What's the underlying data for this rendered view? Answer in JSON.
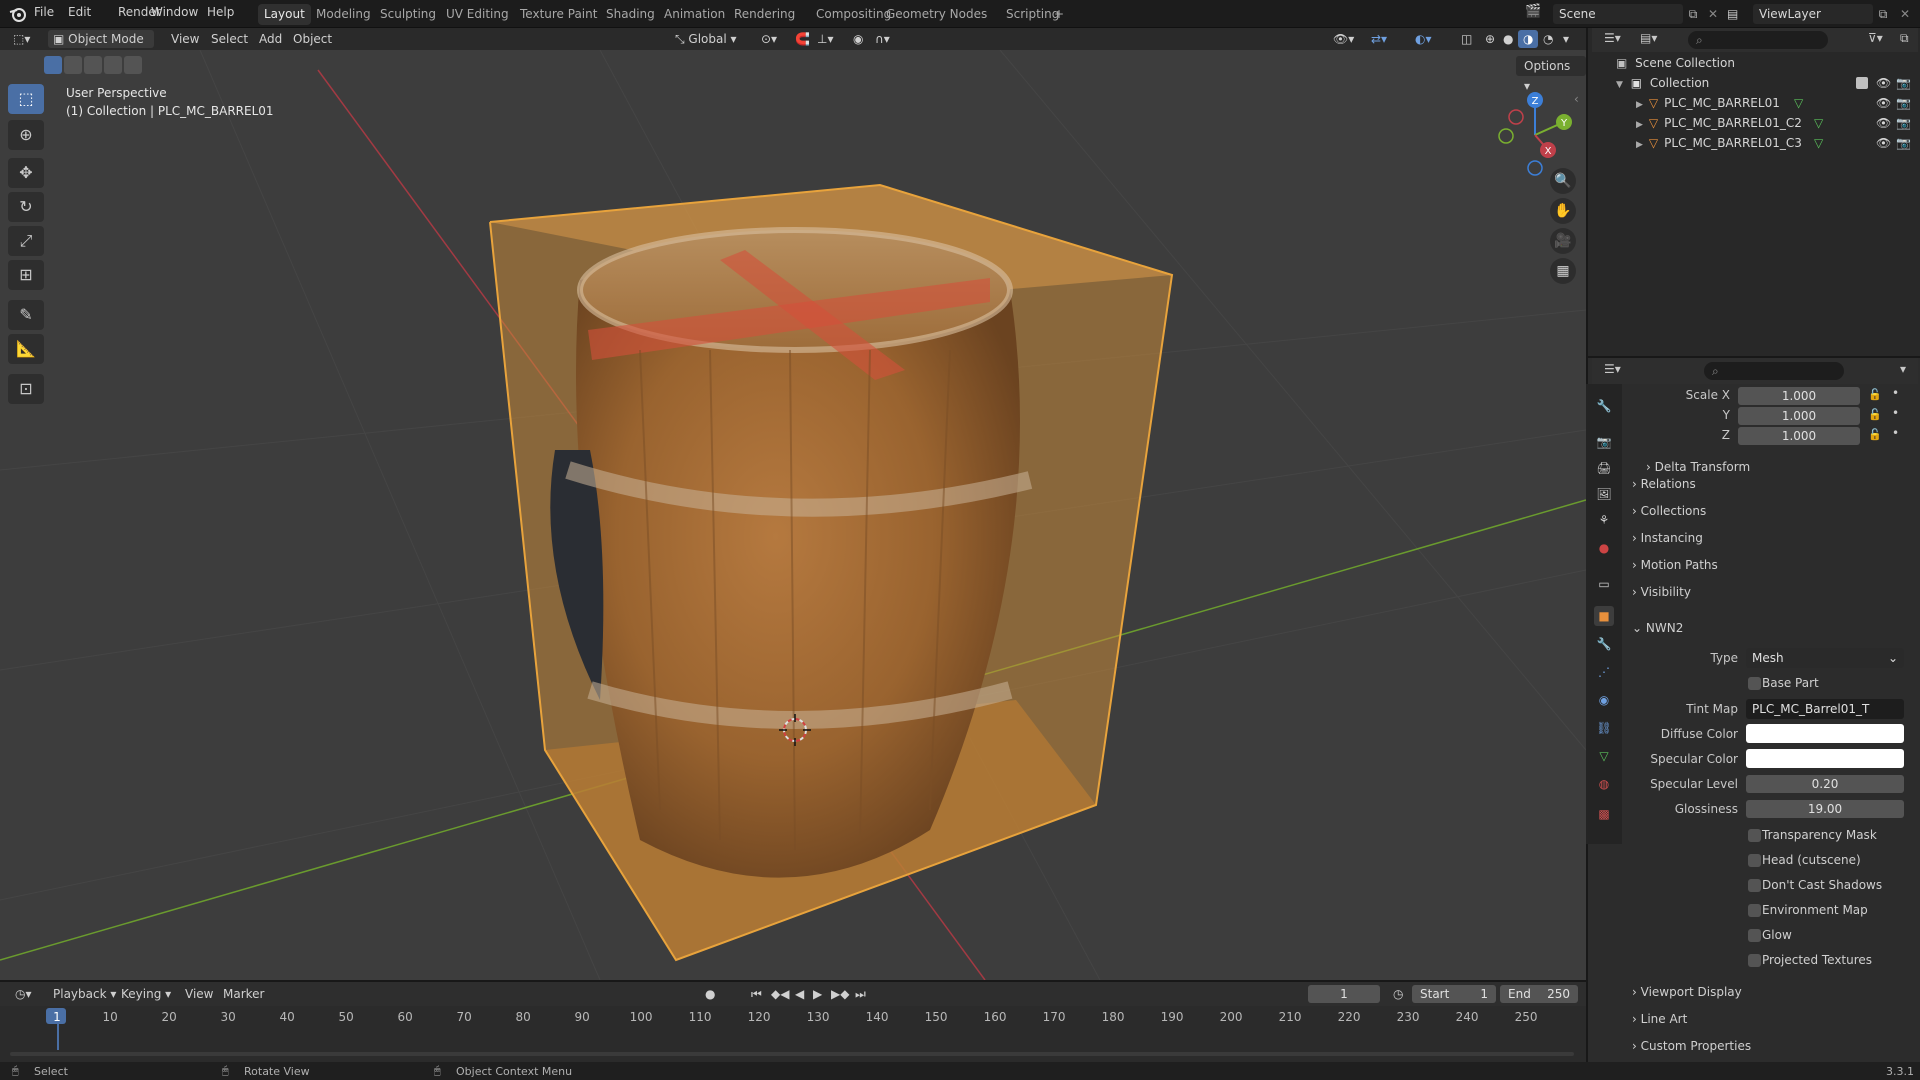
{
  "menu": {
    "file": "File",
    "edit": "Edit",
    "render": "Render",
    "window": "Window",
    "help": "Help"
  },
  "workspaces": [
    "Layout",
    "Modeling",
    "Sculpting",
    "UV Editing",
    "Texture Paint",
    "Shading",
    "Animation",
    "Rendering",
    "Compositing",
    "Geometry Nodes",
    "Scripting",
    "+"
  ],
  "scene": {
    "name": "Scene",
    "view_layer": "ViewLayer"
  },
  "viewport_header": {
    "mode": "Object Mode",
    "view": "View",
    "select": "Select",
    "add": "Add",
    "object": "Object",
    "orientation": "Global",
    "options": "Options"
  },
  "viewport": {
    "perspective": "User Perspective",
    "collection_info": "(1) Collection | PLC_MC_BARREL01"
  },
  "gizmo": {
    "x": "X",
    "y": "Y",
    "z": "Z"
  },
  "outliner": {
    "scene_collection": "Scene Collection",
    "collection": "Collection",
    "objects": [
      "PLC_MC_BARREL01",
      "PLC_MC_BARREL01_C2",
      "PLC_MC_BARREL01_C3"
    ]
  },
  "properties": {
    "scale": {
      "label_x": "Scale X",
      "label_y": "Y",
      "label_z": "Z",
      "x": "1.000",
      "y": "1.000",
      "z": "1.000"
    },
    "sections": [
      "Delta Transform",
      "Relations",
      "Collections",
      "Instancing",
      "Motion Paths",
      "Visibility"
    ],
    "nwn2": {
      "title": "NWN2",
      "type_label": "Type",
      "type_value": "Mesh",
      "base_part": "Base Part",
      "tint_map_label": "Tint Map",
      "tint_map_value": "PLC_MC_Barrel01_T",
      "diffuse_label": "Diffuse Color",
      "specular_label": "Specular Color",
      "spec_level_label": "Specular Level",
      "spec_level_value": "0.20",
      "gloss_label": "Glossiness",
      "gloss_value": "19.00",
      "checks": [
        "Transparency Mask",
        "Head (cutscene)",
        "Don't Cast Shadows",
        "Environment Map",
        "Glow",
        "Projected Textures"
      ]
    },
    "bottom_sections": [
      "Viewport Display",
      "Line Art",
      "Custom Properties"
    ]
  },
  "timeline": {
    "playback": "Playback",
    "keying": "Keying",
    "view": "View",
    "marker": "Marker",
    "current_frame": "1",
    "start_label": "Start",
    "start": "1",
    "end_label": "End",
    "end": "250",
    "ticks": [
      "1",
      "10",
      "20",
      "30",
      "40",
      "50",
      "60",
      "70",
      "80",
      "90",
      "100",
      "110",
      "120",
      "130",
      "140",
      "150",
      "160",
      "170",
      "180",
      "190",
      "200",
      "210",
      "220",
      "230",
      "240",
      "250"
    ]
  },
  "status": {
    "select": "Select",
    "rotate": "Rotate View",
    "context": "Object Context Menu",
    "version": "3.3.1"
  },
  "colors": {
    "accent": "#4a6fa5",
    "selection_orange": "#e8a33c",
    "x_axis": "#c0404a",
    "y_axis": "#7ab030",
    "z_axis": "#3c7fd8"
  }
}
